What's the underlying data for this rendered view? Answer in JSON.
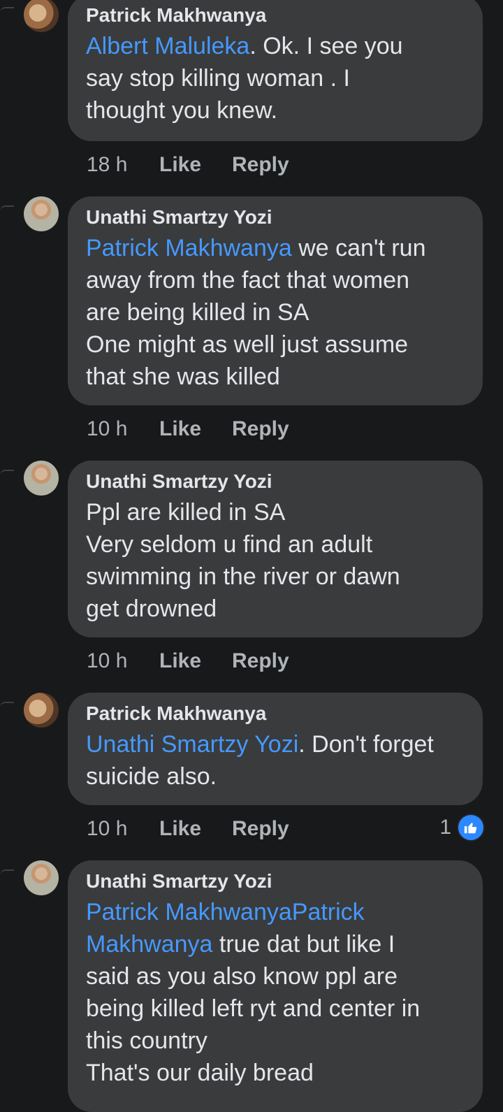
{
  "comments": [
    {
      "author": "Patrick Makhwanya",
      "mention": "Albert Maluleka",
      "text": ". Ok. I see you\nsay stop killing woman . I\nthought you knew.",
      "time": "18 h",
      "like": "Like",
      "reply": "Reply"
    },
    {
      "author": "Unathi Smartzy Yozi",
      "mention": "Patrick Makhwanya",
      "text": " we can't run\naway from the fact that women\nare being killed in SA\nOne might as well just assume\nthat she was killed",
      "time": "10 h",
      "like": "Like",
      "reply": "Reply"
    },
    {
      "author": "Unathi Smartzy Yozi",
      "mention": "",
      "text": "Ppl are killed in SA\nVery seldom u find an adult\nswimming in the river or dawn\nget drowned",
      "time": "10 h",
      "like": "Like",
      "reply": "Reply"
    },
    {
      "author": "Patrick Makhwanya",
      "mention": "Unathi Smartzy Yozi",
      "text": ". Don't forget\nsuicide also.",
      "time": "10 h",
      "like": "Like",
      "reply": "Reply",
      "reaction_count": "1"
    },
    {
      "author": "Unathi Smartzy Yozi",
      "mention": "Patrick MakhwanyaPatrick\nMakhwanya",
      "text": " true dat but like I\nsaid as you also know ppl are\nbeing killed left ryt and center in\nthis country\nThat's our daily bread"
    }
  ],
  "colors": {
    "background": "#18191a",
    "bubble": "#3a3b3c",
    "mention": "#4599ff",
    "like_badge": "#2d88ff"
  },
  "icons": {
    "reaction": "thumbs-up-icon"
  }
}
